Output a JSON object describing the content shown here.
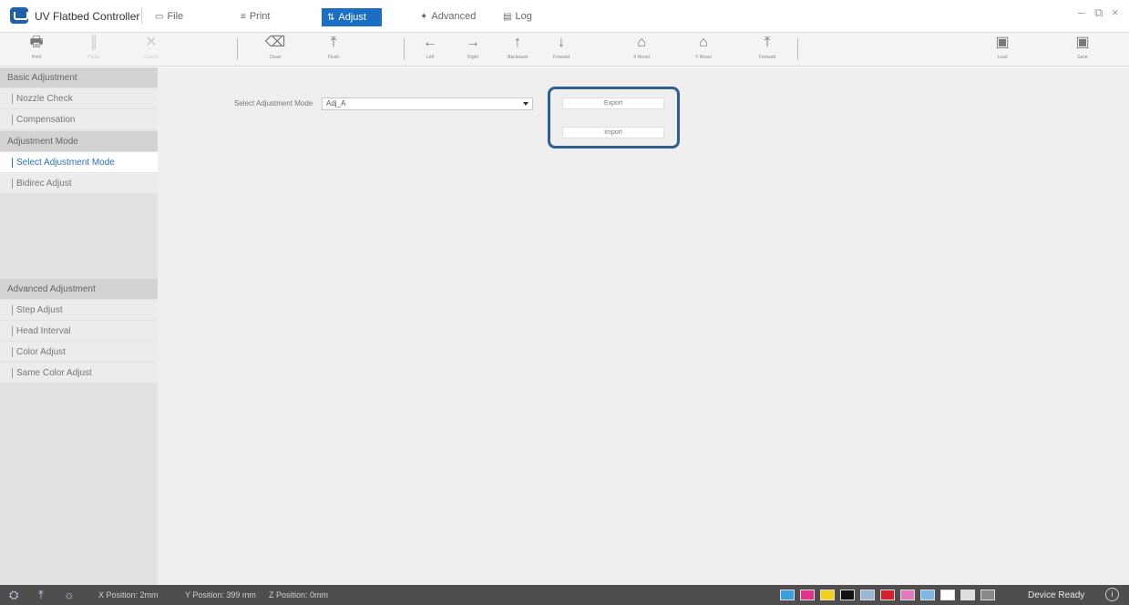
{
  "app": {
    "title": "UV Flatbed Controller"
  },
  "menu": {
    "tabs": [
      {
        "label": "File",
        "icon": "file-icon"
      },
      {
        "label": "Print",
        "icon": "print-icon"
      },
      {
        "label": "Adjust",
        "icon": "adjust-icon",
        "active": true
      },
      {
        "label": "Advanced",
        "icon": "advanced-icon"
      },
      {
        "label": "Log",
        "icon": "log-icon"
      }
    ]
  },
  "window_controls": {
    "minimize": "–",
    "restore": "⧉",
    "close": "×"
  },
  "toolbar": {
    "print": "Print",
    "pause": "Pause",
    "cancel": "Cancel",
    "clean": "Clean",
    "flush": "Flush",
    "left": "Left",
    "right": "Right",
    "backward": "Backward",
    "forward": "Forward",
    "x_reset": "X Reset",
    "y_reset": "Y Reset",
    "feed_top": "Forward",
    "load": "Load",
    "save": "Save"
  },
  "sidebar": {
    "sections": [
      {
        "title": "Basic Adjustment",
        "items": [
          "Nozzle Check",
          "Compensation"
        ]
      },
      {
        "title": "Adjustment Mode",
        "items": [
          "Select Adjustment Mode",
          "Bidirec Adjust"
        ]
      },
      {
        "title": "Advanced Adjustment",
        "items": [
          "Step Adjust",
          "Head Interval",
          "Color Adjust",
          "Same Color Adjust"
        ]
      }
    ],
    "selected": "Select Adjustment Mode"
  },
  "main": {
    "mode_label": "Select Adjustment Mode",
    "mode_value": "Adj_A",
    "export_label": "Export",
    "import_label": "Import"
  },
  "status": {
    "x_position": "X Position: 2mm",
    "y_position": "Y Position: 399 mm",
    "z_position": "Z Position: 0mm",
    "device_state": "Device Ready",
    "inks": [
      "#3aa0dc",
      "#e0368a",
      "#f2d11c",
      "#111111",
      "#9ab8d8",
      "#d6202a",
      "#e07bb8",
      "#7ab8e8",
      "#ffffff",
      "#dddddd",
      "#888888"
    ]
  },
  "colors": {
    "accent": "#1a6fc4",
    "highlight_box": "#2f5f8f",
    "status_bar": "#4e4e4e"
  }
}
